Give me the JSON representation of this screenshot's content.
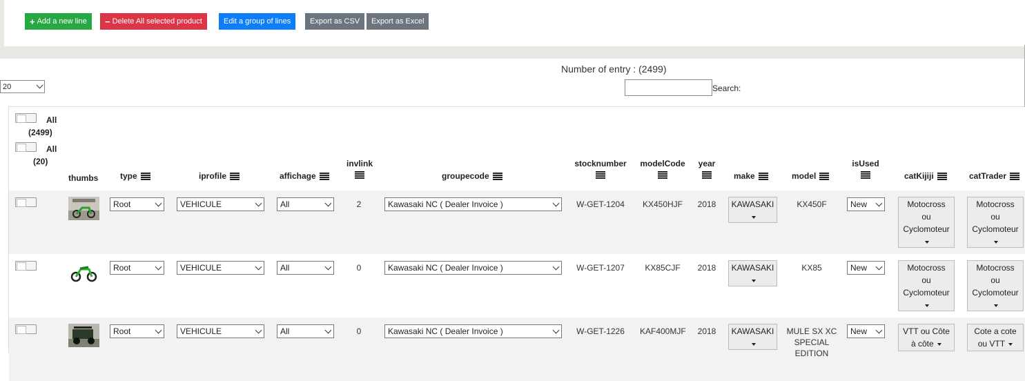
{
  "toolbar": {
    "add_label": "Add a new line",
    "delete_label": "Delete All selected product",
    "edit_group_label": "Edit a group of lines",
    "export_csv_label": "Export as CSV",
    "export_excel_label": "Export as Excel",
    "colors": {
      "green": "#28a745",
      "red": "#dc3545",
      "blue": "#0d7ef7",
      "gray": "#6c757d"
    }
  },
  "list_controls": {
    "entry_count": "Number of entry : (2499)",
    "page_size": "20",
    "search_label": "Search:",
    "search_value": ""
  },
  "header": {
    "select_all_label": "All",
    "select_all_count": "(2499)",
    "select_page_label": "All",
    "select_page_count": "(20)",
    "columns": {
      "thumbs": "thumbs",
      "type": "type",
      "iprofile": "iprofile",
      "affichage": "affichage",
      "invlink": "invlink",
      "groupecode": "groupecode",
      "stocknumber": "stocknumber",
      "modelCode": "modelCode",
      "year": "year",
      "make": "make",
      "model": "model",
      "isUsed": "isUsed",
      "catKijiji": "catKijiji",
      "catTrader": "catTrader"
    }
  },
  "rows": [
    {
      "type": "Root",
      "iprofile": "VEHICULE",
      "affichage": "All",
      "invlink": "2",
      "groupecode": "Kawasaki NC ( Dealer Invoice )",
      "stocknumber": "W-GET-1204",
      "modelCode": "KX450HJF",
      "year": "2018",
      "make": "KAWASAKI",
      "model": "KX450F",
      "isUsed": "New",
      "catKijiji": [
        "Motocross",
        "ou",
        "Cyclomoteur"
      ],
      "catTrader": [
        "Motocross",
        "ou",
        "Cyclomoteur"
      ],
      "thumb_icon": "dirt-bike-photo-thumb"
    },
    {
      "type": "Root",
      "iprofile": "VEHICULE",
      "affichage": "All",
      "invlink": "0",
      "groupecode": "Kawasaki NC ( Dealer Invoice )",
      "stocknumber": "W-GET-1207",
      "modelCode": "KX85CJF",
      "year": "2018",
      "make": "KAWASAKI",
      "model": "KX85",
      "isUsed": "New",
      "catKijiji": [
        "Motocross",
        "ou",
        "Cyclomoteur"
      ],
      "catTrader": [
        "Motocross",
        "ou",
        "Cyclomoteur"
      ],
      "thumb_icon": "dirt-bike-cutout-thumb"
    },
    {
      "type": "Root",
      "iprofile": "VEHICULE",
      "affichage": "All",
      "invlink": "0",
      "groupecode": "Kawasaki NC ( Dealer Invoice )",
      "stocknumber": "W-GET-1226",
      "modelCode": "KAF400MJF",
      "year": "2018",
      "make": "KAWASAKI",
      "model": [
        "MULE SX XC",
        "SPECIAL",
        "EDITION"
      ],
      "isUsed": "New",
      "catKijiji": [
        "VTT ou Côte",
        "à côte"
      ],
      "catTrader": [
        "Cote a cote",
        "ou VTT"
      ],
      "thumb_icon": "utility-vehicle-thumb"
    }
  ]
}
